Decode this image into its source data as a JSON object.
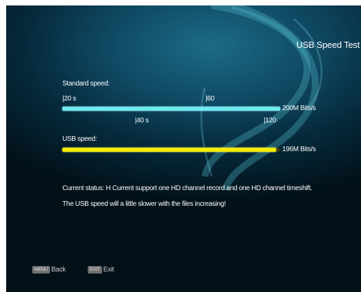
{
  "screen": {
    "title": "USB Speed Test"
  },
  "standard": {
    "label": "Standard speed:",
    "ticks": [
      "|20 s",
      "|60",
      "|40 s",
      "|120"
    ],
    "value_label": "200M Bits/s",
    "fill_fraction": 1.0,
    "color": "#6ee9ef"
  },
  "usb": {
    "label": "USB speed:",
    "value_label": "196M Bits/s",
    "fill_fraction": 0.98,
    "color": "#f3ec00"
  },
  "status": {
    "line1": "Current status: H Current support one HD channel record and one HD channel timeshift.",
    "line2": "The USB speed will a little slower with the files increasing!"
  },
  "footer": {
    "back_key": "MENU",
    "back_label": "Back",
    "exit_key": "EXIT",
    "exit_label": "Exit"
  }
}
